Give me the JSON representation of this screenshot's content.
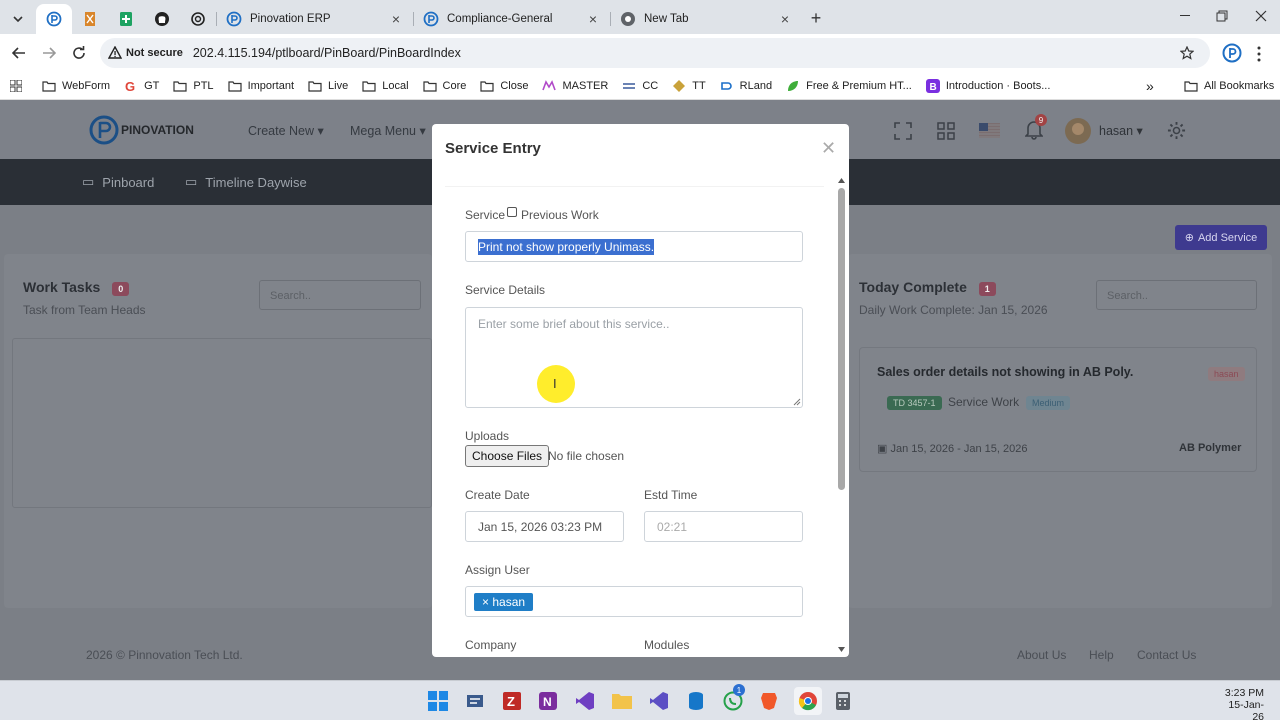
{
  "browser": {
    "tabs": [
      {
        "title": "Pinovation ERP",
        "close": "×"
      },
      {
        "title": "Compliance-General",
        "close": "×"
      },
      {
        "title": "New Tab",
        "close": "×"
      }
    ],
    "new_tab": "+",
    "security_label": "Not secure",
    "url": "202.4.115.194/ptlboard/PinBoard/PinBoardIndex",
    "bookmarks": [
      "WebForm",
      "GT",
      "PTL",
      "Important",
      "Live",
      "Local",
      "Core",
      "Close",
      "MASTER",
      "CC",
      "TT",
      "RLand",
      "Free & Premium HT...",
      "Introduction · Boots..."
    ],
    "bookmarks_more": "»",
    "all_bookmarks": "All Bookmarks"
  },
  "app": {
    "logo_text": "PINOVATION",
    "menu": [
      "Create New",
      "Mega Menu"
    ],
    "notification_count": "9",
    "user_name": "hasan",
    "nav": [
      "Pinboard",
      "Timeline Daywise"
    ],
    "add_service": "Add Service",
    "work_tasks": {
      "title": "Work Tasks",
      "count": "0",
      "subtitle": "Task from Team Heads",
      "search_placeholder": "Search.."
    },
    "today_complete": {
      "title": "Today Complete",
      "count": "1",
      "subtitle": "Daily Work Complete: Jan 15, 2026",
      "search_placeholder": "Search..",
      "task": {
        "title": "Sales order details not showing in AB Poly.",
        "user": "hasan",
        "code": "TD 3457-1",
        "type": "Service Work",
        "priority": "Medium",
        "dates": "Jan 15, 2026 - Jan 15, 2026",
        "company": "AB Polymer"
      }
    },
    "footer": {
      "copyright": "2026 © Pinnovation Tech Ltd.",
      "links": [
        "About Us",
        "Help",
        "Contact Us"
      ]
    }
  },
  "modal": {
    "title": "Service Entry",
    "service_label": "Service",
    "previous_work_label": "Previous Work",
    "service_value": "Print not show properly Unimass.",
    "details_label": "Service Details",
    "details_placeholder": "Enter some brief about this service..",
    "uploads_label": "Uploads",
    "choose_files": "Choose Files",
    "no_file": "No file chosen",
    "create_date_label": "Create Date",
    "create_date_value": "Jan 15, 2026 03:23 PM",
    "estd_time_label": "Estd Time",
    "estd_time_value": "02:21",
    "assign_user_label": "Assign User",
    "assigned_user": "hasan",
    "assigned_remove": "×",
    "company_label": "Company",
    "modules_label": "Modules"
  },
  "taskbar": {
    "time": "3:23 PM",
    "date": "15-Jan-26",
    "whatsapp_badge": "1"
  }
}
